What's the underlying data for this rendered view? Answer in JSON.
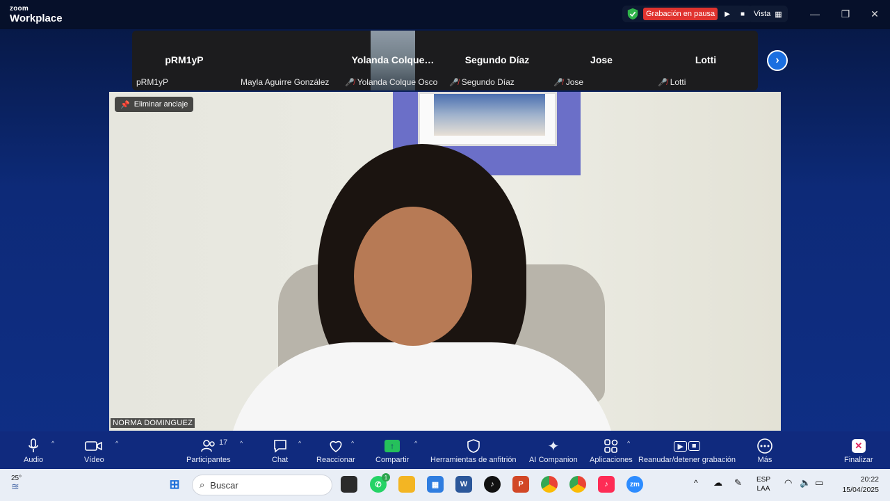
{
  "app": {
    "brand_small": "zoom",
    "brand_big": "Workplace"
  },
  "recording": {
    "label": "Grabación en pausa",
    "view_label": "Vista",
    "status_color": "#e0332f"
  },
  "participants_strip": [
    {
      "big": "pRM1yP",
      "small": "pRM1yP",
      "muted": false
    },
    {
      "big": "",
      "small": "Mayla Aguirre González",
      "muted": false
    },
    {
      "big": "Yolanda  Colque…",
      "small": "Yolanda Colque Osco",
      "muted": true
    },
    {
      "big": "Segundo Díaz",
      "small": "Segundo Díaz",
      "muted": true
    },
    {
      "big": "Jose",
      "small": "Jose",
      "muted": true
    },
    {
      "big": "Lotti",
      "small": "Lotti",
      "muted": true
    }
  ],
  "main_video": {
    "unpin_label": "Eliminar anclaje",
    "speaker_name": "NORMA DOMINGUEZ"
  },
  "toolbar": {
    "audio": "Audio",
    "video": "Vídeo",
    "participants": "Participantes",
    "participants_count": "17",
    "chat": "Chat",
    "react": "Reaccionar",
    "share": "Compartir",
    "host_tools": "Herramientas de anfitrión",
    "ai": "AI Companion",
    "apps": "Aplicaciones",
    "record": "Reanudar/detener grabación",
    "more": "Más",
    "end": "Finalizar"
  },
  "taskbar": {
    "temperature": "25°",
    "search_placeholder": "Buscar",
    "whatsapp_badge": "1",
    "lang_top": "ESP",
    "lang_bottom": "LAA",
    "time": "20:22",
    "date": "15/04/2025"
  }
}
